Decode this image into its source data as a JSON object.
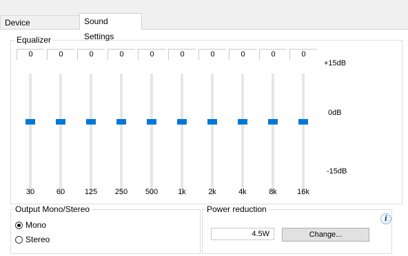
{
  "tabs": [
    {
      "label": "Device Parameters",
      "active": false
    },
    {
      "label": "Sound Settings",
      "active": true
    }
  ],
  "equalizer": {
    "title": "Equalizer",
    "bands": [
      {
        "freq": "30",
        "value": "0"
      },
      {
        "freq": "60",
        "value": "0"
      },
      {
        "freq": "125",
        "value": "0"
      },
      {
        "freq": "250",
        "value": "0"
      },
      {
        "freq": "500",
        "value": "0"
      },
      {
        "freq": "1k",
        "value": "0"
      },
      {
        "freq": "2k",
        "value": "0"
      },
      {
        "freq": "4k",
        "value": "0"
      },
      {
        "freq": "8k",
        "value": "0"
      },
      {
        "freq": "16k",
        "value": "0"
      }
    ],
    "scale": {
      "top": "+15dB",
      "mid": "0dB",
      "bottom": "-15dB"
    },
    "slider_accent": "#0078d7"
  },
  "output": {
    "title": "Output Mono/Stereo",
    "options": [
      {
        "label": "Mono",
        "selected": true
      },
      {
        "label": "Stereo",
        "selected": false
      }
    ]
  },
  "power": {
    "title": "Power reduction",
    "value": "4.5W",
    "button_label": "Change...",
    "info_icon": "info-icon"
  }
}
